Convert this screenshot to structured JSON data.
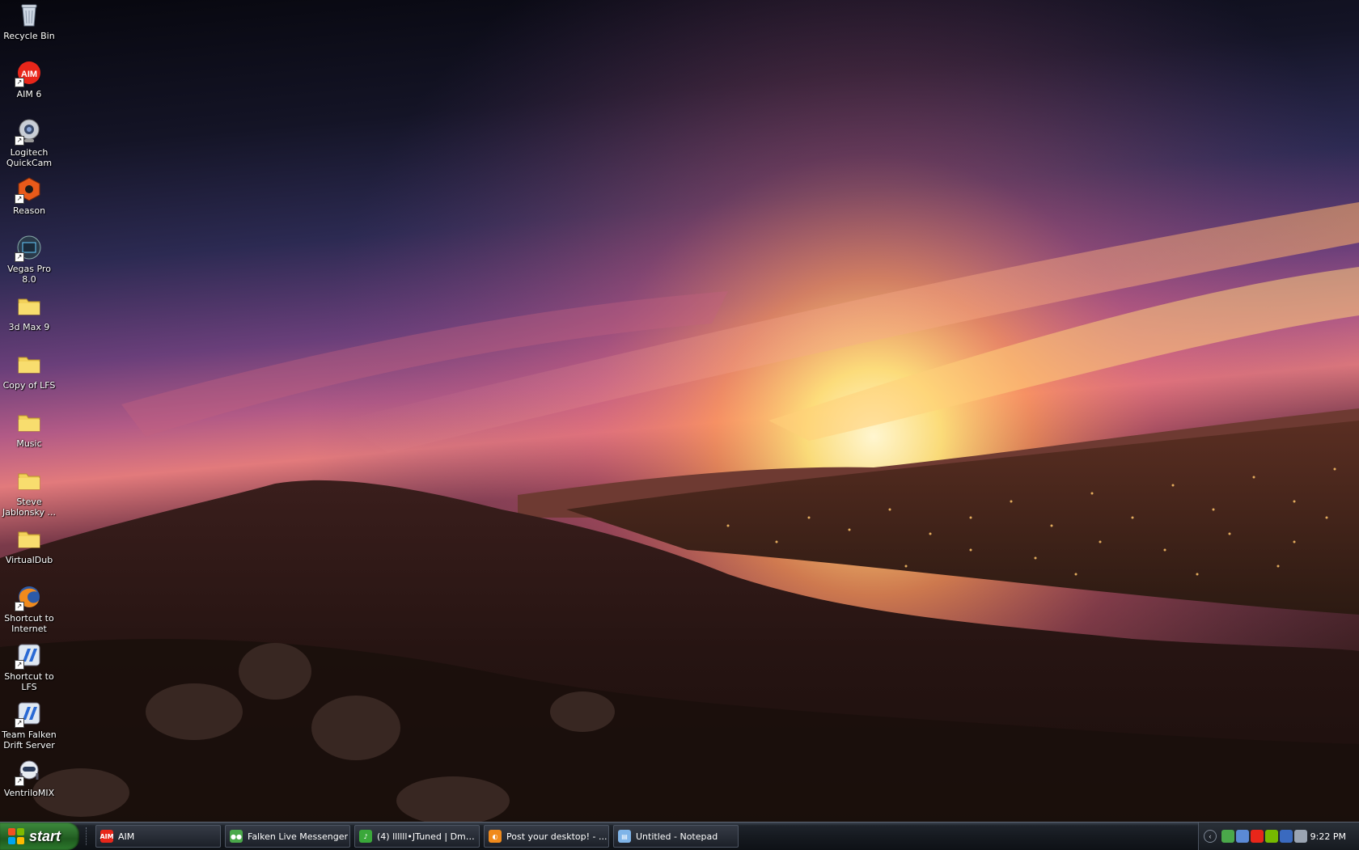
{
  "desktop": {
    "icons": [
      {
        "label": "Recycle Bin",
        "icon": "recycle-bin-icon",
        "shortcut": false
      },
      {
        "label": "AIM 6",
        "icon": "aim-icon",
        "shortcut": true
      },
      {
        "label": "Logitech QuickCam",
        "icon": "webcam-icon",
        "shortcut": true
      },
      {
        "label": "Reason",
        "icon": "reason-icon",
        "shortcut": true
      },
      {
        "label": "Vegas Pro 8.0",
        "icon": "vegas-icon",
        "shortcut": true
      },
      {
        "label": "3d Max 9",
        "icon": "folder-icon",
        "shortcut": false
      },
      {
        "label": "Copy of LFS",
        "icon": "folder-icon",
        "shortcut": false
      },
      {
        "label": "Music",
        "icon": "folder-icon",
        "shortcut": false
      },
      {
        "label": "Steve Jablonsky ...",
        "icon": "folder-icon",
        "shortcut": false
      },
      {
        "label": "VirtualDub",
        "icon": "folder-icon",
        "shortcut": false
      },
      {
        "label": "Shortcut to Internet",
        "icon": "firefox-icon",
        "shortcut": true
      },
      {
        "label": "Shortcut to LFS",
        "icon": "lfs-icon",
        "shortcut": true
      },
      {
        "label": "Team Falken Drift Server",
        "icon": "lfs-icon",
        "shortcut": true
      },
      {
        "label": "VentriloMIX",
        "icon": "ventrilo-icon",
        "shortcut": true
      }
    ]
  },
  "taskbar": {
    "start_label": "start",
    "tasks": [
      {
        "label": "AIM",
        "icon": "aim-icon"
      },
      {
        "label": "Falken Live Messenger",
        "icon": "messenger-icon"
      },
      {
        "label": "(4) llllll•JTuned | Dma...",
        "icon": "chat-icon"
      },
      {
        "label": "Post your desktop! - ...",
        "icon": "firefox-icon"
      },
      {
        "label": "Untitled - Notepad",
        "icon": "notepad-icon"
      }
    ],
    "tray": {
      "icons": [
        "show-hidden-icon",
        "messenger-tray-icon",
        "network-icon",
        "aim-tray-icon",
        "nvidia-icon",
        "security-icon",
        "volume-icon"
      ],
      "clock": "9:22 PM"
    }
  },
  "colors": {
    "start_green": "#2b6b2b",
    "taskbar_dark": "#161a20",
    "sky_top": "#0b0a14",
    "horizon_glow": "#ffe27a"
  }
}
